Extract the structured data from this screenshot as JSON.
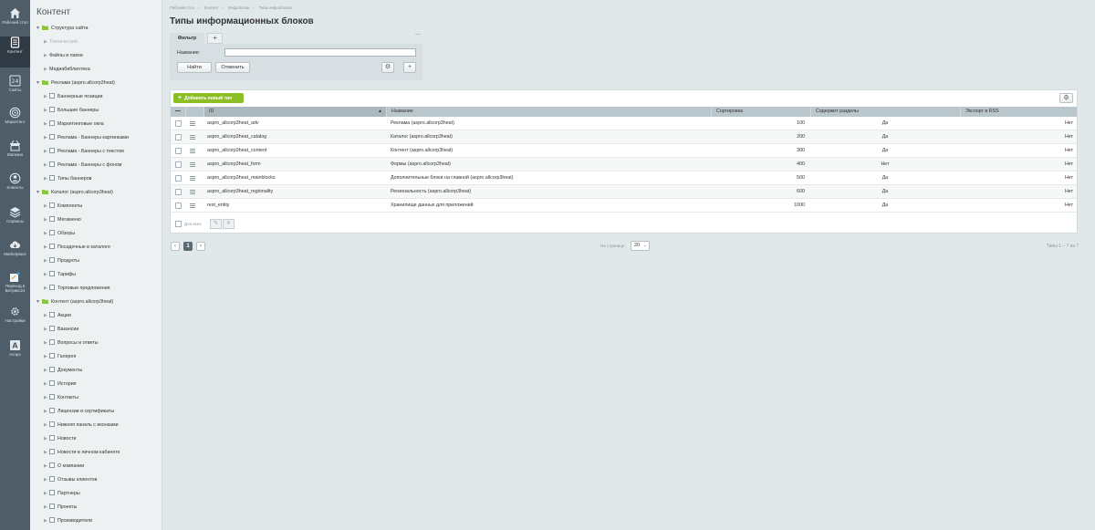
{
  "leftbar": [
    {
      "label": "Рабочий стол",
      "icon": "home-icon"
    },
    {
      "label": "Контент",
      "icon": "document-icon",
      "active": true
    },
    {
      "label": "Сайты",
      "icon": "sites-24-icon"
    },
    {
      "label": "Маркетинг",
      "icon": "target-icon"
    },
    {
      "label": "Магазин",
      "icon": "cart-icon"
    },
    {
      "label": "Клиенты",
      "icon": "clients-icon"
    },
    {
      "label": "Сервисы",
      "icon": "layers-icon"
    },
    {
      "label": "Marketplace",
      "icon": "cloud-icon"
    },
    {
      "label": "Переход в Битрикс24",
      "icon": "sparkle-icon"
    },
    {
      "label": "Настройки",
      "icon": "gear-icon"
    },
    {
      "label": "Аспро",
      "icon": "a-icon"
    }
  ],
  "tree": {
    "title": "Контент",
    "items": [
      {
        "label": "Структура сайта",
        "level": 0,
        "type": "folder"
      },
      {
        "label": "Технический",
        "level": 1,
        "type": "plain",
        "dim": true
      },
      {
        "label": "Файлы и папки",
        "level": 1,
        "type": "plain"
      },
      {
        "label": "Медиабиблиотека",
        "level": 1,
        "type": "plain"
      },
      {
        "label": "Реклама (aspro.allcorp3heat)",
        "level": 0,
        "type": "folder"
      },
      {
        "label": "Баннерные позиции",
        "level": 1,
        "type": "grid"
      },
      {
        "label": "Большие баннеры",
        "level": 1,
        "type": "grid"
      },
      {
        "label": "Маркетинговые окна",
        "level": 1,
        "type": "grid"
      },
      {
        "label": "Реклама - Баннеры картинками",
        "level": 1,
        "type": "grid"
      },
      {
        "label": "Реклама - Баннеры с текстом",
        "level": 1,
        "type": "grid"
      },
      {
        "label": "Реклама - Баннеры с фоном",
        "level": 1,
        "type": "grid"
      },
      {
        "label": "Типы баннеров",
        "level": 1,
        "type": "grid"
      },
      {
        "label": "Каталог (aspro.allcorp3heat)",
        "level": 0,
        "type": "folder"
      },
      {
        "label": "Комплекты",
        "level": 1,
        "type": "grid"
      },
      {
        "label": "Мегаменю",
        "level": 1,
        "type": "grid"
      },
      {
        "label": "Обзоры",
        "level": 1,
        "type": "grid"
      },
      {
        "label": "Посадочные в каталоге",
        "level": 1,
        "type": "grid"
      },
      {
        "label": "Продукты",
        "level": 1,
        "type": "grid"
      },
      {
        "label": "Тарифы",
        "level": 1,
        "type": "grid"
      },
      {
        "label": "Торговые предложения",
        "level": 1,
        "type": "grid"
      },
      {
        "label": "Контент (aspro.allcorp3heat)",
        "level": 0,
        "type": "folder"
      },
      {
        "label": "Акции",
        "level": 1,
        "type": "grid"
      },
      {
        "label": "Вакансии",
        "level": 1,
        "type": "grid"
      },
      {
        "label": "Вопросы и ответы",
        "level": 1,
        "type": "grid"
      },
      {
        "label": "Галерея",
        "level": 1,
        "type": "grid"
      },
      {
        "label": "Документы",
        "level": 1,
        "type": "grid"
      },
      {
        "label": "История",
        "level": 1,
        "type": "grid"
      },
      {
        "label": "Контакты",
        "level": 1,
        "type": "grid"
      },
      {
        "label": "Лицензии и сертификаты",
        "level": 1,
        "type": "grid"
      },
      {
        "label": "Нижняя панель с иконками",
        "level": 1,
        "type": "grid"
      },
      {
        "label": "Новости",
        "level": 1,
        "type": "grid"
      },
      {
        "label": "Новости в личном кабинете",
        "level": 1,
        "type": "grid"
      },
      {
        "label": "О компании",
        "level": 1,
        "type": "grid"
      },
      {
        "label": "Отзывы клиентов",
        "level": 1,
        "type": "grid"
      },
      {
        "label": "Партнеры",
        "level": 1,
        "type": "grid"
      },
      {
        "label": "Проекты",
        "level": 1,
        "type": "grid"
      },
      {
        "label": "Производители",
        "level": 1,
        "type": "grid"
      }
    ]
  },
  "breadcrumb": [
    "Рабочий стол",
    "Контент",
    "Инфоблоки",
    "Типы инфоблоков"
  ],
  "page_title": "Типы информационных блоков",
  "filter": {
    "tab_label": "Фильтр",
    "add_tab": "+",
    "minimize": "—",
    "field_label": "Название:",
    "field_value": "",
    "find": "Найти",
    "cancel": "Отменить"
  },
  "grid": {
    "add_button": "Добавить новый тип",
    "columns": [
      "ID",
      "Название",
      "Сортировка",
      "Содержит разделы",
      "Экспорт в RSS"
    ],
    "rows": [
      {
        "id": "aspro_allcorp3heat_adv",
        "name": "Реклама (aspro.allcorp3heat)",
        "sort": "100",
        "sections": "Да",
        "rss": "Нет"
      },
      {
        "id": "aspro_allcorp3heat_catalog",
        "name": "Каталог (aspro.allcorp3heat)",
        "sort": "200",
        "sections": "Да",
        "rss": "Нет"
      },
      {
        "id": "aspro_allcorp3heat_content",
        "name": "Контент (aspro.allcorp3heat)",
        "sort": "300",
        "sections": "Да",
        "rss": "Нет"
      },
      {
        "id": "aspro_allcorp3heat_form",
        "name": "Формы (aspro.allcorp3heat)",
        "sort": "400",
        "sections": "Нет",
        "rss": "Нет"
      },
      {
        "id": "aspro_allcorp3heat_mainblocks",
        "name": "Дополнительные блоки на главной (aspro.allcorp3heat)",
        "sort": "500",
        "sections": "Да",
        "rss": "Нет"
      },
      {
        "id": "aspro_allcorp3heat_regionality",
        "name": "Региональность (aspro.allcorp3heat)",
        "sort": "600",
        "sections": "Да",
        "rss": "Нет"
      },
      {
        "id": "rest_entity",
        "name": "Хранилище данных для приложений",
        "sort": "1000",
        "sections": "Да",
        "rss": "Нет"
      }
    ],
    "footer_label": "Для всех"
  },
  "pagination": {
    "prev": "‹",
    "current": "1",
    "next": "›",
    "per_page_label": "На странице:",
    "per_page": "20",
    "total": "Типы 1 – 7 из 7"
  },
  "colors": {
    "accent_green": "#8cbf26",
    "sidebar_dark": "#4f5d69"
  }
}
